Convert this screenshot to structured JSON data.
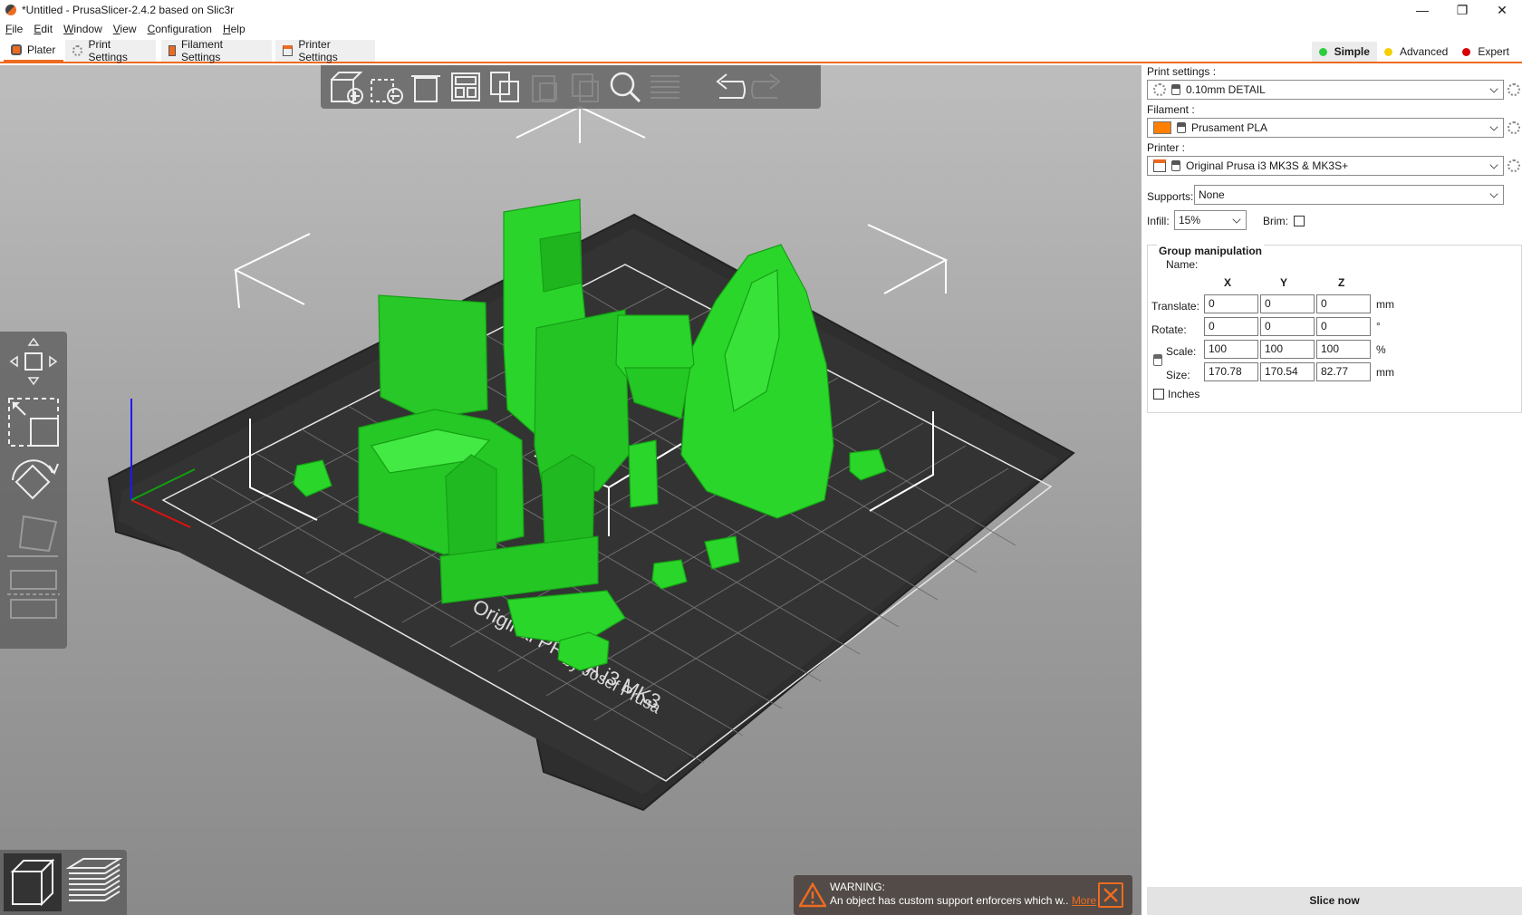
{
  "window": {
    "title": "*Untitled - PrusaSlicer-2.4.2 based on Slic3r",
    "minimize_glyph": "—",
    "maximize_glyph": "❐",
    "close_glyph": "✕"
  },
  "menu": [
    "File",
    "Edit",
    "Window",
    "View",
    "Configuration",
    "Help"
  ],
  "tabs": [
    {
      "label": "Plater",
      "active": true
    },
    {
      "label": "Print Settings",
      "active": false
    },
    {
      "label": "Filament Settings",
      "active": false
    },
    {
      "label": "Printer Settings",
      "active": false
    }
  ],
  "modes": [
    {
      "label": "Simple",
      "color": "#2ecc40",
      "active": true
    },
    {
      "label": "Advanced",
      "color": "#f5d000",
      "active": false
    },
    {
      "label": "Expert",
      "color": "#d90000",
      "active": false
    }
  ],
  "bed": {
    "brand_line1": "Original PRUSA i3 MK3",
    "brand_line2": "by Josef Prusa"
  },
  "sidebar": {
    "print_settings": {
      "label": "Print settings :",
      "value": "0.10mm DETAIL"
    },
    "filament": {
      "label": "Filament :",
      "value": "Prusament PLA",
      "color": "#ff7f00"
    },
    "printer": {
      "label": "Printer :",
      "value": "Original Prusa i3 MK3S & MK3S+"
    },
    "supports": {
      "label": "Supports:",
      "value": "None"
    },
    "infill": {
      "label": "Infill:",
      "value": "15%"
    },
    "brim": {
      "label": "Brim:",
      "checked": false
    },
    "group": {
      "title": "Group manipulation",
      "name_label": "Name:",
      "axes": [
        "X",
        "Y",
        "Z"
      ],
      "translate": {
        "label": "Translate:",
        "x": "0",
        "y": "0",
        "z": "0",
        "unit": "mm"
      },
      "rotate": {
        "label": "Rotate:",
        "x": "0",
        "y": "0",
        "z": "0",
        "unit": "°"
      },
      "scale": {
        "label": "Scale:",
        "x": "100",
        "y": "100",
        "z": "100",
        "unit": "%"
      },
      "size": {
        "label": "Size:",
        "x": "170.78",
        "y": "170.54",
        "z": "82.77",
        "unit": "mm"
      },
      "inches_label": "Inches"
    },
    "slice_button": "Slice now"
  },
  "warning": {
    "title": "WARNING:",
    "message": "An object has custom support enforcers which w..",
    "link": "More"
  },
  "colors": {
    "accent": "#ed6b21",
    "model_green": "#22dd22",
    "bed": "#2d2d2d"
  }
}
